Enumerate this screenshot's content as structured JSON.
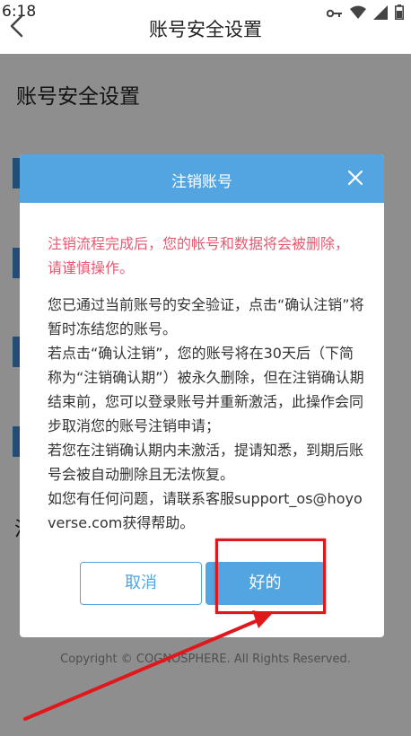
{
  "status_bar": {
    "time": "6:18"
  },
  "header": {
    "title": "账号安全设置"
  },
  "page": {
    "section_title": "账号安全设置",
    "partial_text": "注",
    "copyright": "Copyright © COGNOSPHERE. All Rights Reserved."
  },
  "dialog": {
    "title": "注销账号",
    "warning": "注销流程完成后，您的帐号和数据将会被删除，请谨慎操作。",
    "body": [
      "您已通过当前账号的安全验证，点击“确认注销”将暂时冻结您的账号。",
      "若点击“确认注销”，您的账号将在30天后（下简称为“注销确认期”）被永久删除，但在注销确认期结束前，您可以登录账号并重新激活，此操作会同步取消您的账号注销申请；",
      "若您在注销确认期内未激活，提请知悉，到期后账号会被自动删除且无法恢复。",
      "如您有任何问题，请联系客服support_os@hoyoverse.com获得帮助。"
    ],
    "cancel_label": "取消",
    "ok_label": "好的"
  },
  "colors": {
    "accent": "#52a5e0",
    "warning": "#e65a72",
    "annotation": "#e0181c"
  }
}
